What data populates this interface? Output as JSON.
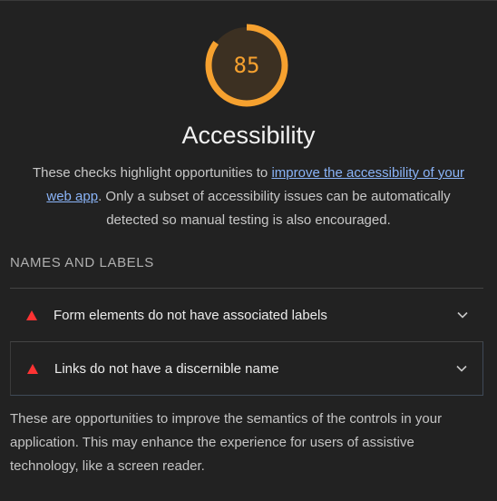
{
  "category": {
    "score": "85",
    "score_fraction": 0.85,
    "score_color": "#f6a12f",
    "title": "Accessibility",
    "description_before": "These checks highlight opportunities to ",
    "description_link": "improve the accessibility of your web app",
    "description_after": ". Only a subset of accessibility issues can be automatically detected so manual testing is also encouraged."
  },
  "group": {
    "title": "NAMES AND LABELS",
    "audits": [
      {
        "label": "Form elements do not have associated labels",
        "status": "fail",
        "icon": "fail-triangle-icon"
      },
      {
        "label": "Links do not have a discernible name",
        "status": "fail",
        "icon": "fail-triangle-icon"
      }
    ],
    "footer": "These are opportunities to improve the semantics of the controls in your application. This may enhance the experience for users of assistive technology, like a screen reader."
  },
  "colors": {
    "background": "#222222",
    "fail": "#ff3333",
    "link": "#8ab4f8"
  }
}
